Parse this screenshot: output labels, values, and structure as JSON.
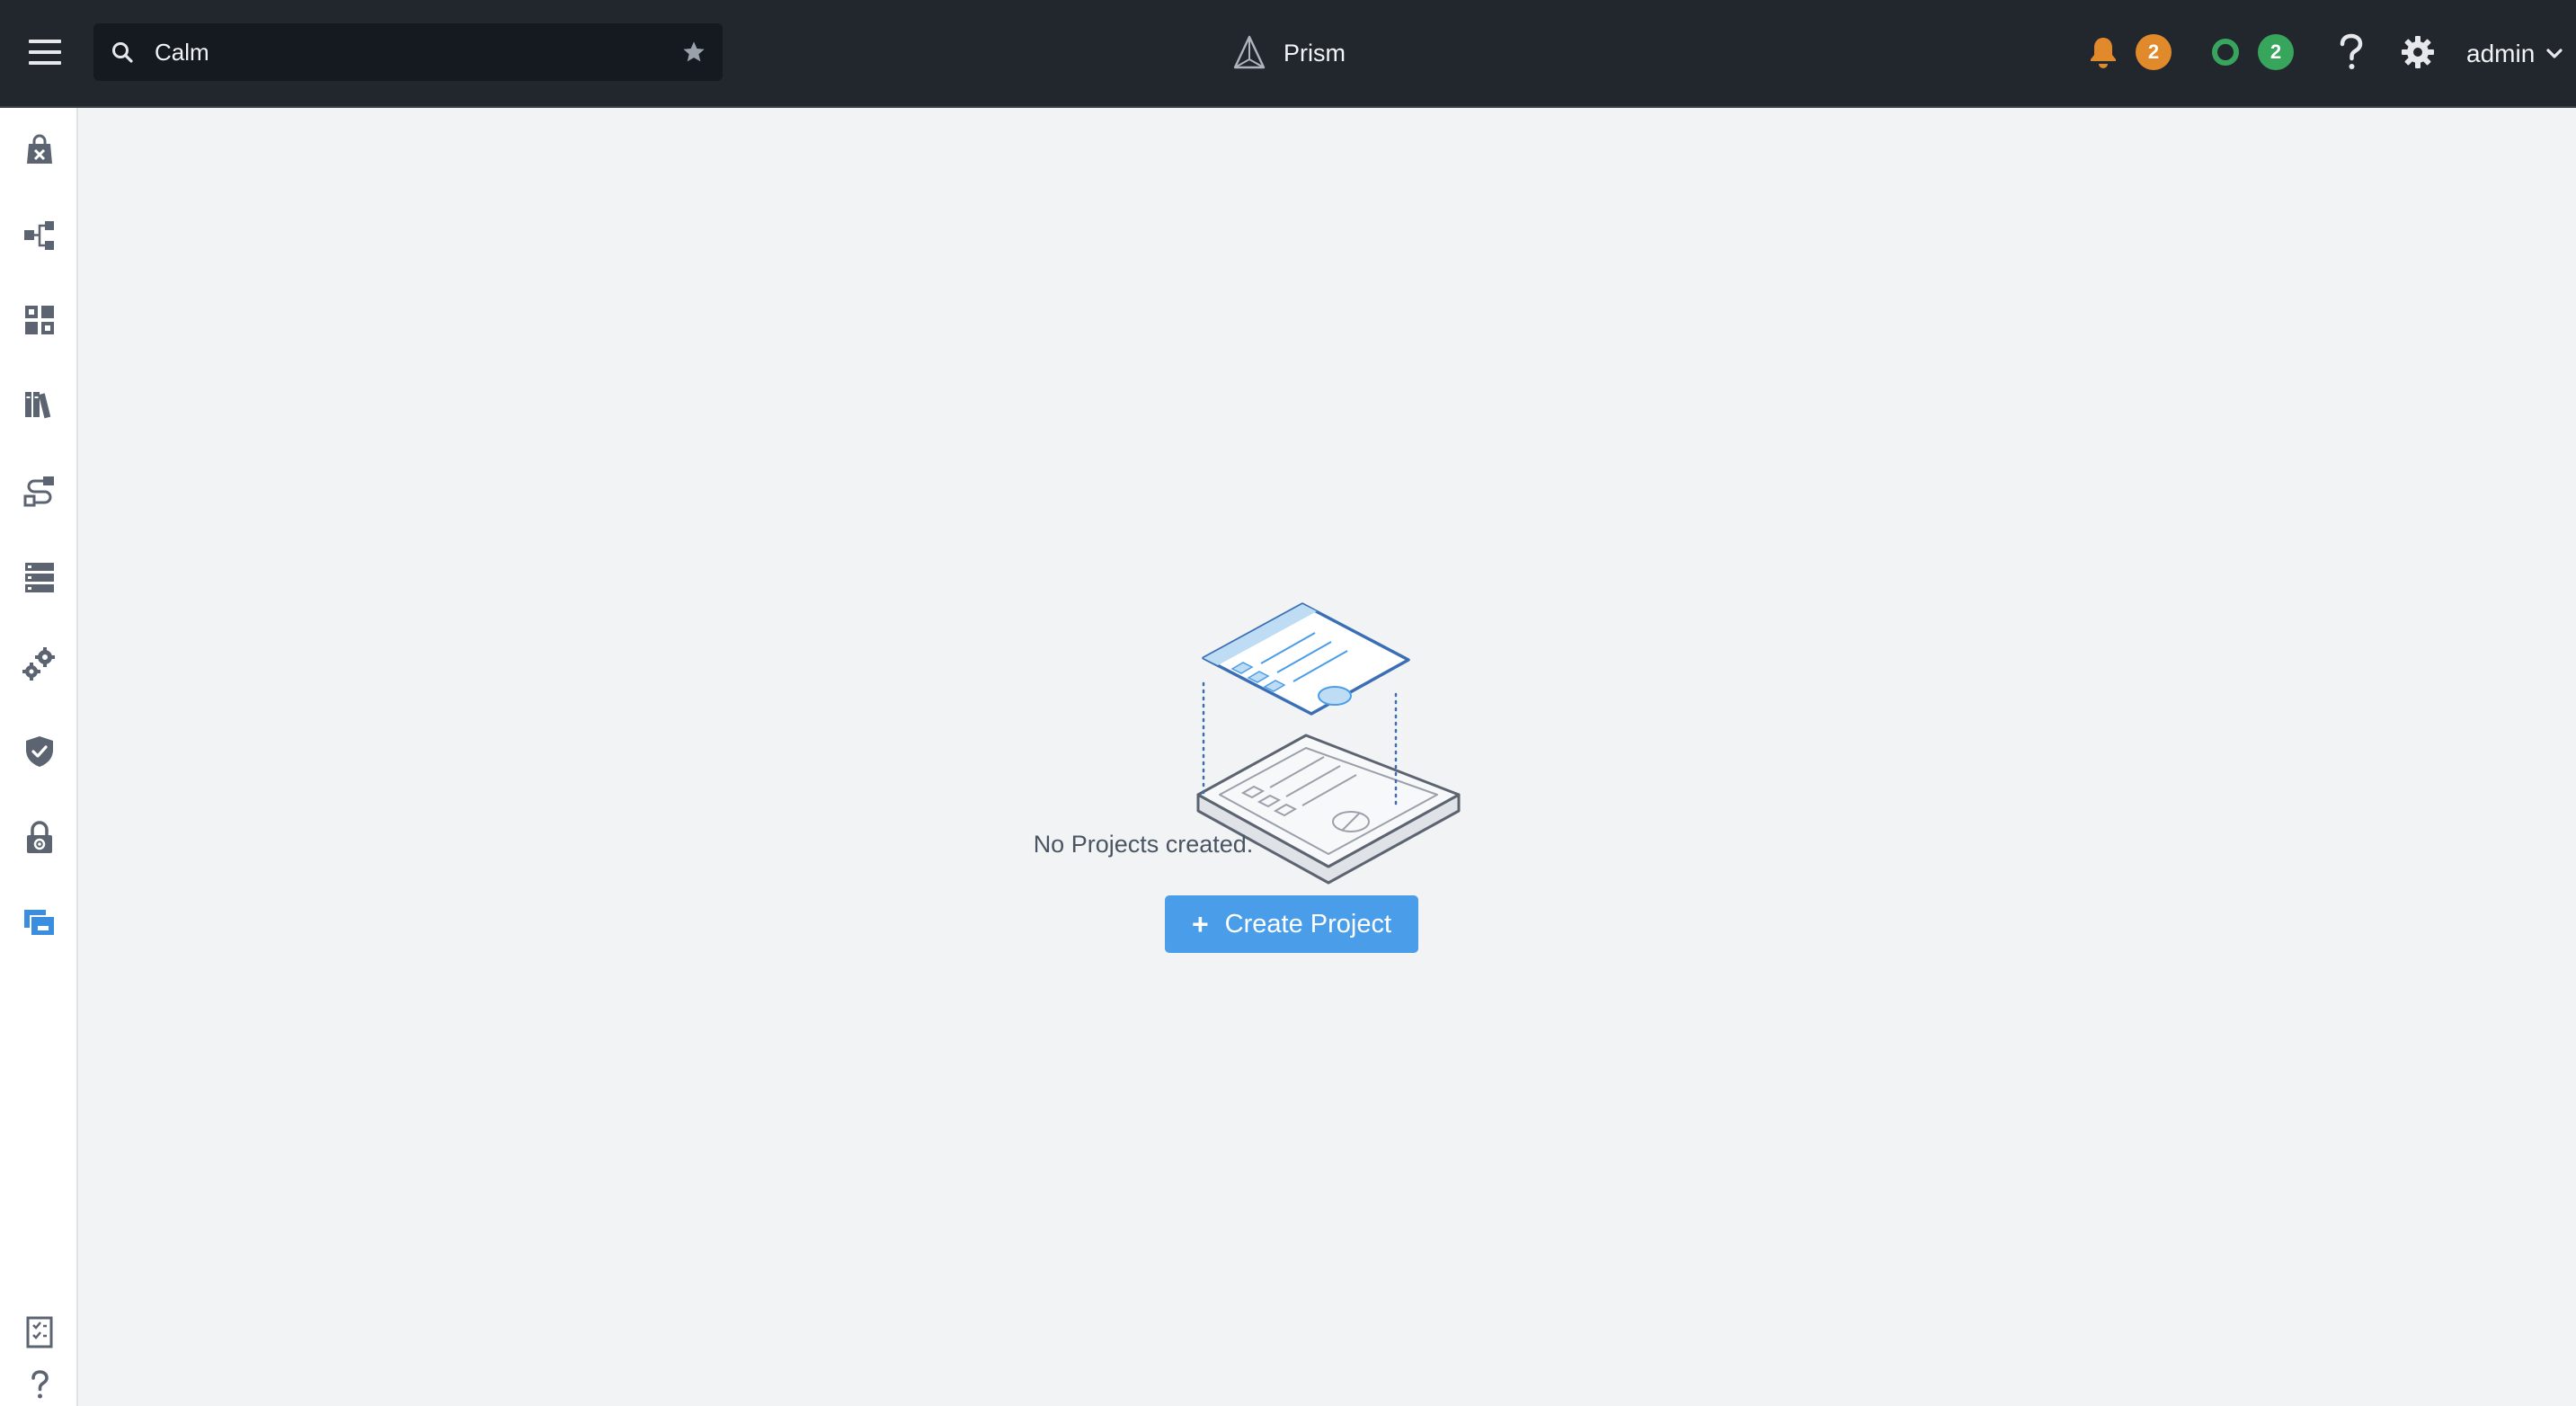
{
  "topbar": {
    "search": {
      "value": "Calm",
      "placeholder": ""
    },
    "brand": "Prism",
    "alerts_count": "2",
    "tasks_count": "2",
    "user": "admin"
  },
  "sidebar": {
    "items": [
      {
        "icon": "apps-icon"
      },
      {
        "icon": "blueprints-icon"
      },
      {
        "icon": "marketplace-icon"
      },
      {
        "icon": "library-icon"
      },
      {
        "icon": "runbooks-icon"
      },
      {
        "icon": "endpoints-icon"
      },
      {
        "icon": "settings-gears-icon"
      },
      {
        "icon": "policies-shield-icon"
      },
      {
        "icon": "security-lock-icon"
      },
      {
        "icon": "projects-icon",
        "active": true
      }
    ],
    "bottom": [
      {
        "icon": "checklist-icon"
      },
      {
        "icon": "help-icon"
      }
    ]
  },
  "main": {
    "empty_message": "No Projects created.",
    "create_button": "Create Project",
    "create_icon": "+"
  },
  "colors": {
    "topbar": "#22272e",
    "accent": "#4a9ee9",
    "alert_badge": "#e08a2b",
    "task_badge": "#38a55c",
    "sidebar_icon": "#5b6470",
    "sidebar_active": "#3b8de0"
  }
}
